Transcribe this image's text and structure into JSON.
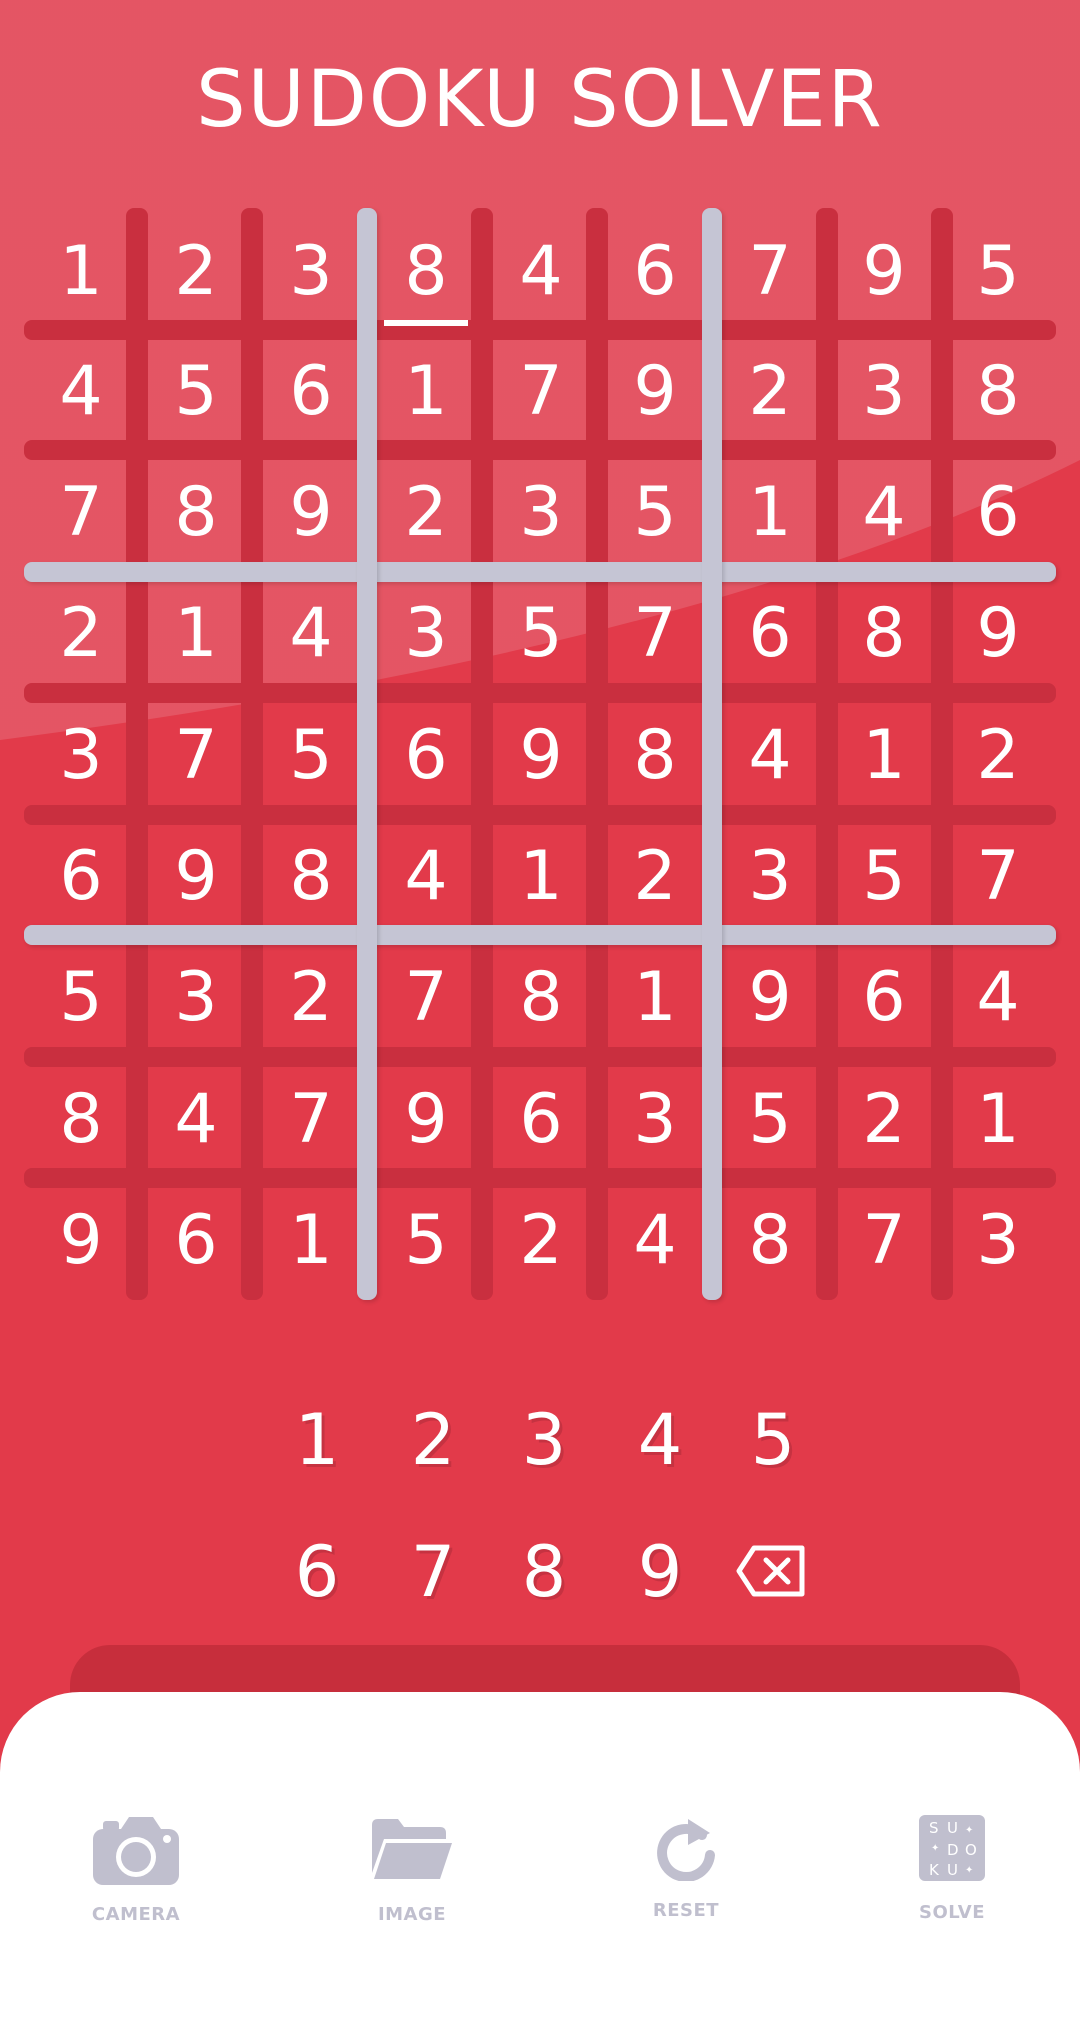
{
  "title": "SUDOKU SOLVER",
  "grid": [
    [
      "1",
      "2",
      "3",
      "8",
      "4",
      "6",
      "7",
      "9",
      "5"
    ],
    [
      "4",
      "5",
      "6",
      "1",
      "7",
      "9",
      "2",
      "3",
      "8"
    ],
    [
      "7",
      "8",
      "9",
      "2",
      "3",
      "5",
      "1",
      "4",
      "6"
    ],
    [
      "2",
      "1",
      "4",
      "3",
      "5",
      "7",
      "6",
      "8",
      "9"
    ],
    [
      "3",
      "7",
      "5",
      "6",
      "9",
      "8",
      "4",
      "1",
      "2"
    ],
    [
      "6",
      "9",
      "8",
      "4",
      "1",
      "2",
      "3",
      "5",
      "7"
    ],
    [
      "5",
      "3",
      "2",
      "7",
      "8",
      "1",
      "9",
      "6",
      "4"
    ],
    [
      "8",
      "4",
      "7",
      "9",
      "6",
      "3",
      "5",
      "2",
      "1"
    ],
    [
      "9",
      "6",
      "1",
      "5",
      "2",
      "4",
      "8",
      "7",
      "3"
    ]
  ],
  "selected_cell": {
    "row": 0,
    "col": 3
  },
  "keypad": {
    "row1": [
      "1",
      "2",
      "3",
      "4",
      "5"
    ],
    "row2": [
      "6",
      "7",
      "8",
      "9"
    ],
    "backspace_icon": "backspace-icon"
  },
  "bottom_bar": {
    "camera_label": "CAMERA",
    "image_label": "IMAGE",
    "reset_label": "RESET",
    "solve_label": "SOLVE",
    "solve_icon_letters": [
      "S",
      "U",
      "D",
      "O",
      "K",
      "U"
    ]
  },
  "colors": {
    "background": "#e23a4a",
    "thin_line": "#c92f3f",
    "thick_line": "#c5c5d4",
    "icon_gray": "#c0bfce"
  }
}
